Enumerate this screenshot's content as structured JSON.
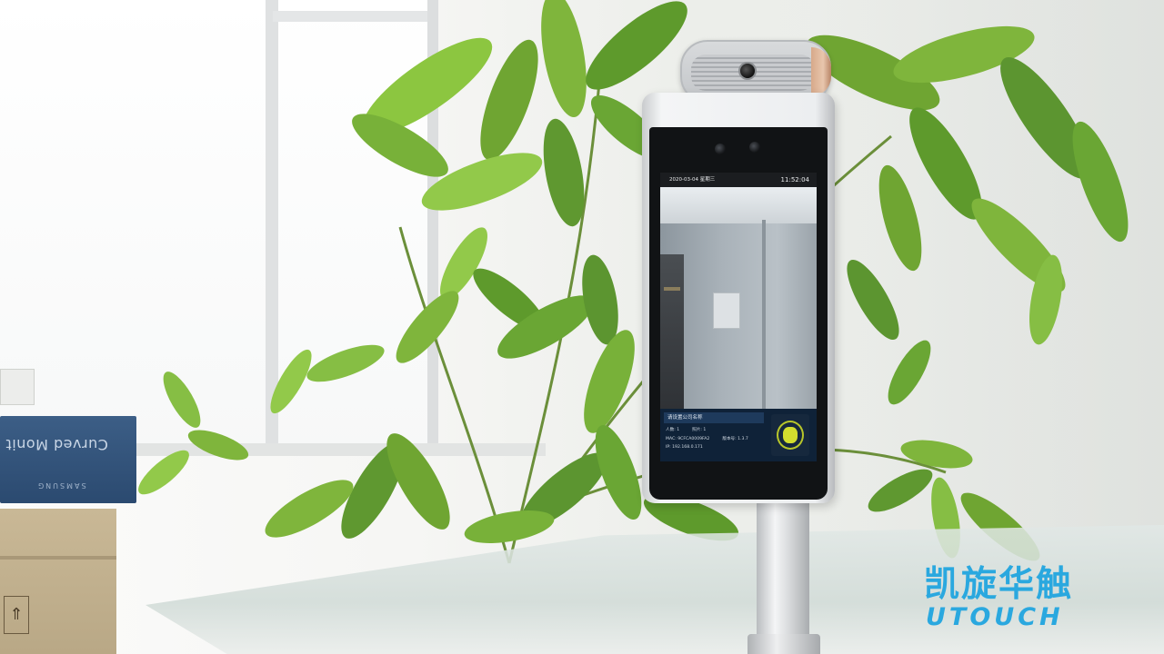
{
  "scene": {
    "box_print": "Curved Monit",
    "box_brand": "SAMSUNG"
  },
  "screen": {
    "date": "2020-03-04 星期三",
    "time": "11:52:04",
    "company_placeholder": "请设置公司名称",
    "stats": {
      "people_label": "人数: 1",
      "photos_label": "照片: 1",
      "mac_label": "MAC: 9CFCA0009FA2",
      "version_label": "版本号: 1.3.7",
      "ip_label": "IP: 192.168.0.171"
    },
    "accent_color": "#d3de2e"
  },
  "logo": {
    "chinese": "凯旋华触",
    "english": "UTOUCH",
    "color": "#2aa8df"
  }
}
